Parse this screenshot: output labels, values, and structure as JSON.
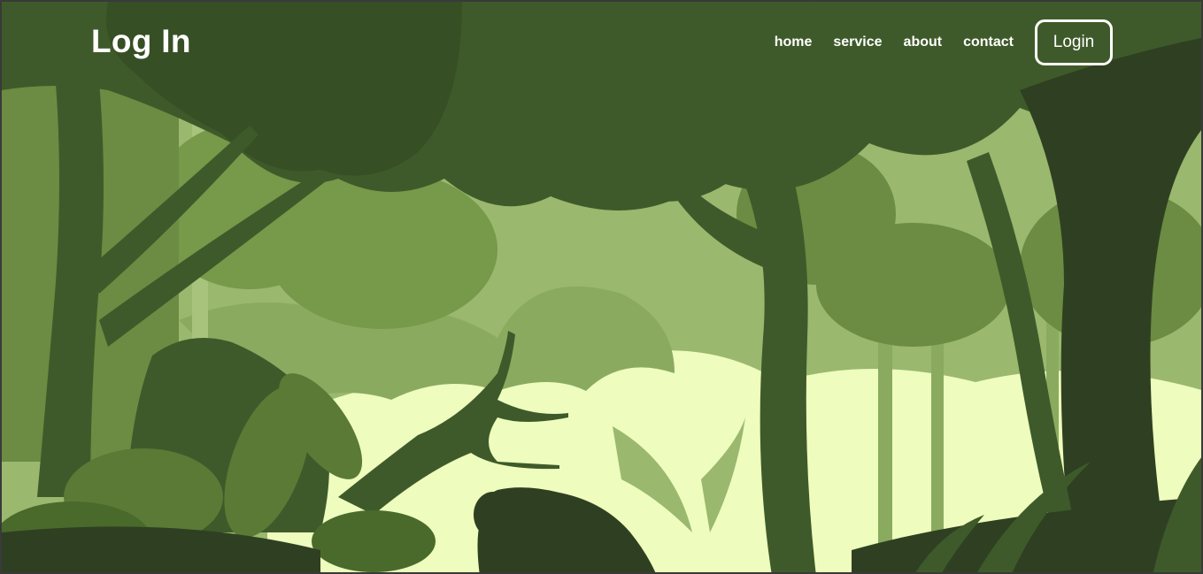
{
  "header": {
    "brand": "Log In",
    "nav": [
      {
        "label": "home"
      },
      {
        "label": "service"
      },
      {
        "label": "about"
      },
      {
        "label": "contact"
      }
    ],
    "login_label": "Login"
  },
  "colors": {
    "sky_light": "#eefcbd",
    "mid_green": "#9ab86e",
    "leaf_green": "#76994a",
    "tree_dark": "#3f5a2a",
    "tree_darkest": "#2f4022"
  }
}
